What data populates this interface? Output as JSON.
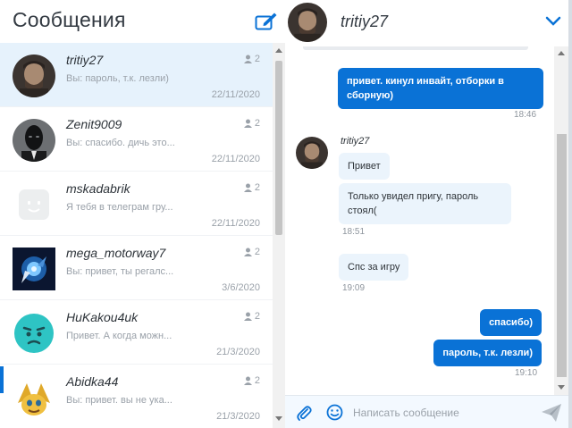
{
  "colors": {
    "accent": "#0a72d6",
    "active_row": "#e6f2fc",
    "incoming_bubble": "#ebf4fc"
  },
  "left": {
    "title": "Сообщения",
    "compose_icon": "compose-icon"
  },
  "conversations": [
    {
      "name": "tritiy27",
      "preview": "Вы: пароль, т.к. лезли)",
      "members": "2",
      "date": "22/11/2020",
      "active": true
    },
    {
      "name": "Zenit9009",
      "preview": "Вы: спасибо. дичь это...",
      "members": "2",
      "date": "22/11/2020"
    },
    {
      "name": "mskadabrik",
      "preview": "Я тебя в телеграм гру...",
      "members": "2",
      "date": "22/11/2020"
    },
    {
      "name": "mega_motorway7",
      "preview": "Вы: привет, ты регалс...",
      "members": "2",
      "date": "3/6/2020"
    },
    {
      "name": "HuKakou4uk",
      "preview": "Привет. А когда можн...",
      "members": "2",
      "date": "21/3/2020"
    },
    {
      "name": "Abidka44",
      "preview": "Вы: привет. вы не ука...",
      "members": "2",
      "date": "21/3/2020"
    }
  ],
  "chat": {
    "title": "tritiy27",
    "messages": [
      {
        "dir": "out",
        "text": "привет. кинул инвайт, отборки в сборную)",
        "time": "18:46"
      },
      {
        "dir": "in",
        "sender": "tritiy27",
        "text": "Привет"
      },
      {
        "dir": "in",
        "text": "Только увидел пригу, пароль стоял(",
        "time": "18:51"
      },
      {
        "dir": "in",
        "text": "Спс за игру",
        "time": "19:09"
      },
      {
        "dir": "out",
        "text": "спасибо)"
      },
      {
        "dir": "out",
        "text": "пароль, т.к. лезли)",
        "time": "19:10"
      }
    ]
  },
  "composer": {
    "placeholder": "Написать сообщение"
  }
}
